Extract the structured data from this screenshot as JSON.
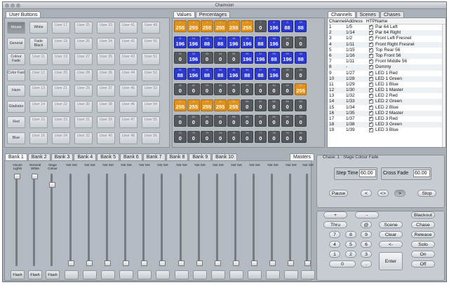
{
  "window": {
    "title": "Chamsion"
  },
  "user_buttons": {
    "tab": "User Buttons",
    "rows": [
      [
        "House",
        "White",
        "User 17",
        "User 25",
        "User 33",
        "User 41",
        "User 49"
      ],
      [
        "General",
        "Fade Black",
        "User 18",
        "User 26",
        "User 34",
        "User 42",
        "User 50"
      ],
      [
        "Colour Fade",
        "User 11",
        "User 19",
        "User 27",
        "User 35",
        "User 43",
        "User 51"
      ],
      [
        "Color Fast",
        "User 12",
        "User 20",
        "User 28",
        "User 36",
        "User 44",
        "User 52"
      ],
      [
        "Haze",
        "User 13",
        "User 21",
        "User 29",
        "User 37",
        "User 45",
        "User 53"
      ],
      [
        "Gladiator",
        "User 14",
        "User 22",
        "User 30",
        "User 38",
        "User 46",
        "User 54"
      ],
      [
        "Red",
        "User 15",
        "User 23",
        "User 31",
        "User 39",
        "User 47",
        "User 55"
      ],
      [
        "Blue",
        "User 16",
        "User 24",
        "User 32",
        "User 40",
        "User 48",
        "User 56"
      ]
    ]
  },
  "values": {
    "tabs": [
      "Values",
      "Percentages"
    ],
    "rows": [
      [
        [
          "1",
          "255",
          "o"
        ],
        [
          "2",
          "255",
          "o"
        ],
        [
          "3",
          "255",
          "o"
        ],
        [
          "4",
          "255",
          "o"
        ],
        [
          "5",
          "255",
          "o"
        ],
        [
          "6",
          "255",
          "o"
        ],
        [
          "7",
          "0",
          "g"
        ],
        [
          "8",
          "196",
          "b"
        ],
        [
          "9",
          "88",
          "b"
        ],
        [
          "10",
          "88",
          "b"
        ]
      ],
      [
        [
          "11",
          "196",
          "b"
        ],
        [
          "12",
          "196",
          "b"
        ],
        [
          "13",
          "88",
          "b"
        ],
        [
          "14",
          "88",
          "b"
        ],
        [
          "15",
          "196",
          "b"
        ],
        [
          "16",
          "196",
          "b"
        ],
        [
          "17",
          "88",
          "b"
        ],
        [
          "18",
          "196",
          "b"
        ],
        [
          "19",
          "0",
          "g"
        ],
        [
          "20",
          "0",
          "g"
        ]
      ],
      [
        [
          "21",
          "0",
          "g"
        ],
        [
          "22",
          "196",
          "b"
        ],
        [
          "23",
          "0",
          "g"
        ],
        [
          "24",
          "0",
          "g"
        ],
        [
          "25",
          "0",
          "g"
        ],
        [
          "26",
          "196",
          "b"
        ],
        [
          "27",
          "196",
          "b"
        ],
        [
          "28",
          "88",
          "b"
        ],
        [
          "29",
          "196",
          "b"
        ],
        [
          "30",
          "88",
          "b"
        ]
      ],
      [
        [
          "31",
          "88",
          "b"
        ],
        [
          "32",
          "196",
          "b"
        ],
        [
          "33",
          "88",
          "b"
        ],
        [
          "34",
          "88",
          "b"
        ],
        [
          "35",
          "196",
          "b"
        ],
        [
          "36",
          "88",
          "b"
        ],
        [
          "37",
          "88",
          "b"
        ],
        [
          "38",
          "196",
          "b"
        ],
        [
          "39",
          "0",
          "g"
        ],
        [
          "40",
          "0",
          "g"
        ]
      ],
      [
        [
          "41",
          "0",
          "g"
        ],
        [
          "42",
          "0",
          "g"
        ],
        [
          "43",
          "0",
          "g"
        ],
        [
          "44",
          "0",
          "g"
        ],
        [
          "45",
          "0",
          "g"
        ],
        [
          "46",
          "0",
          "g"
        ],
        [
          "47",
          "0",
          "g"
        ],
        [
          "48",
          "0",
          "g"
        ],
        [
          "49",
          "0",
          "g"
        ],
        [
          "50",
          "255",
          "o"
        ]
      ],
      [
        [
          "51",
          "255",
          "o"
        ],
        [
          "52",
          "255",
          "o"
        ],
        [
          "53",
          "255",
          "o"
        ],
        [
          "54",
          "255",
          "o"
        ],
        [
          "55",
          "255",
          "o"
        ],
        [
          "56",
          "0",
          "g"
        ],
        [
          "57",
          "0",
          "g"
        ],
        [
          "58",
          "0",
          "g"
        ],
        [
          "59",
          "0",
          "g"
        ],
        [
          "60",
          "0",
          "g"
        ]
      ],
      [
        [
          "61",
          "0",
          "g"
        ],
        [
          "62",
          "0",
          "g"
        ],
        [
          "63",
          "0",
          "g"
        ],
        [
          "64",
          "0",
          "g"
        ],
        [
          "65",
          "0",
          "g"
        ],
        [
          "66",
          "0",
          "g"
        ],
        [
          "67",
          "0",
          "g"
        ],
        [
          "68",
          "0",
          "g"
        ],
        [
          "69",
          "0",
          "g"
        ],
        [
          "70",
          "0",
          "g"
        ]
      ],
      [
        [
          "71",
          "0",
          "g"
        ],
        [
          "72",
          "0",
          "g"
        ],
        [
          "73",
          "0",
          "g"
        ],
        [
          "74",
          "0",
          "g"
        ],
        [
          "75",
          "0",
          "g"
        ],
        [
          "76",
          "0",
          "g"
        ],
        [
          "77",
          "0",
          "g"
        ],
        [
          "78",
          "0",
          "g"
        ],
        [
          "79",
          "0",
          "g"
        ],
        [
          "80",
          "0",
          "g"
        ]
      ]
    ]
  },
  "channels": {
    "tabs": [
      "Channels",
      "Scenes",
      "Chases"
    ],
    "headers": [
      "Channel",
      "Address",
      "HTP",
      "Name"
    ],
    "rows": [
      [
        "1",
        "1/5",
        true,
        "Par 64 Left"
      ],
      [
        "2",
        "1/14",
        true,
        "Par 64 Right"
      ],
      [
        "3",
        "1/2",
        true,
        "Front Left Fresnel"
      ],
      [
        "4",
        "1/11",
        true,
        "Front Right Fresnel"
      ],
      [
        "5",
        "1/15",
        true,
        "Top Rear 56"
      ],
      [
        "6",
        "1/16",
        true,
        "Top Front 56"
      ],
      [
        "7",
        "1/11",
        true,
        "Front Middle 56"
      ],
      [
        "8",
        "-",
        true,
        "Dummy"
      ],
      [
        "9",
        "1/27",
        true,
        "LED 1 Red"
      ],
      [
        "10",
        "1/28",
        true,
        "LED 1 Green"
      ],
      [
        "11",
        "1/29",
        true,
        "LED 1 Blue"
      ],
      [
        "12",
        "1/30",
        true,
        "LED 1 Master"
      ],
      [
        "13",
        "1/32",
        true,
        "LED 2 Red"
      ],
      [
        "14",
        "1/33",
        true,
        "LED 2 Green"
      ],
      [
        "15",
        "1/34",
        true,
        "LED 2 Blue"
      ],
      [
        "16",
        "1/35",
        true,
        "LED 2 Master"
      ],
      [
        "17",
        "1/37",
        true,
        "LED 3 Red"
      ],
      [
        "18",
        "1/38",
        true,
        "LED 3 Green"
      ],
      [
        "19",
        "1/39",
        true,
        "LED 3 Blue"
      ]
    ]
  },
  "banks": {
    "tabs": [
      "Bank 1",
      "Bank 2",
      "Bank 3",
      "Bank 4",
      "Bank 5",
      "Bank 6",
      "Bank 7",
      "Bank 8",
      "Bank 9",
      "Bank 10"
    ],
    "masters_tab": "Masters"
  },
  "faders": [
    {
      "label": "House Lights",
      "level": 1.0,
      "flash": "Flash"
    },
    {
      "label": "General White",
      "level": 1.0,
      "flash": "Flash"
    },
    {
      "label": "Stage Colour",
      "level": 0.9,
      "flash": "Flash"
    },
    {
      "label": "Not Set",
      "level": 0,
      "flash": ""
    },
    {
      "label": "Not Set",
      "level": 0,
      "flash": ""
    },
    {
      "label": "Not Set",
      "level": 0,
      "flash": ""
    },
    {
      "label": "Not Set",
      "level": 0,
      "flash": ""
    },
    {
      "label": "Not Set",
      "level": 0,
      "flash": ""
    },
    {
      "label": "Not Set",
      "level": 0,
      "flash": ""
    },
    {
      "label": "Not Set",
      "level": 0,
      "flash": ""
    },
    {
      "label": "Not Set",
      "level": 0,
      "flash": ""
    },
    {
      "label": "Not Set",
      "level": 0,
      "flash": ""
    },
    {
      "label": "Not Set",
      "level": 0,
      "flash": ""
    },
    {
      "label": "Not Set",
      "level": 0,
      "flash": ""
    },
    {
      "label": "Not Set",
      "level": 0,
      "flash": ""
    },
    {
      "label": "Not Set",
      "level": 0,
      "flash": ""
    },
    {
      "label": "Not Set",
      "level": 0,
      "flash": ""
    }
  ],
  "chase": {
    "title": "Chase: 1 : Stage Colour Fade",
    "step_time_label": "Step Time",
    "step_time": "60.00",
    "cross_fade_label": "Cross Fade",
    "cross_fade": "60.00",
    "pause": "Pause",
    "prev": "<",
    "both": "<>",
    "next": ">",
    "stop": "Stop"
  },
  "keypad": {
    "plus": "+",
    "minus": "-",
    "thru": "Thru",
    "at": "@",
    "scene": "Scene",
    "chase": "Chase",
    "clear": "Clear",
    "release": "Release",
    "back": "<-",
    "solo": "Solo",
    "enter": "Enter",
    "on": "On",
    "off": "Off",
    "blackout": "Blackout",
    "digits": [
      "7",
      "8",
      "9",
      "4",
      "5",
      "6",
      "1",
      "2",
      "3",
      "0",
      "."
    ]
  },
  "colors": {
    "orange": "#e0921a",
    "blue": "#2d3ad1",
    "grey": "#55595e"
  }
}
